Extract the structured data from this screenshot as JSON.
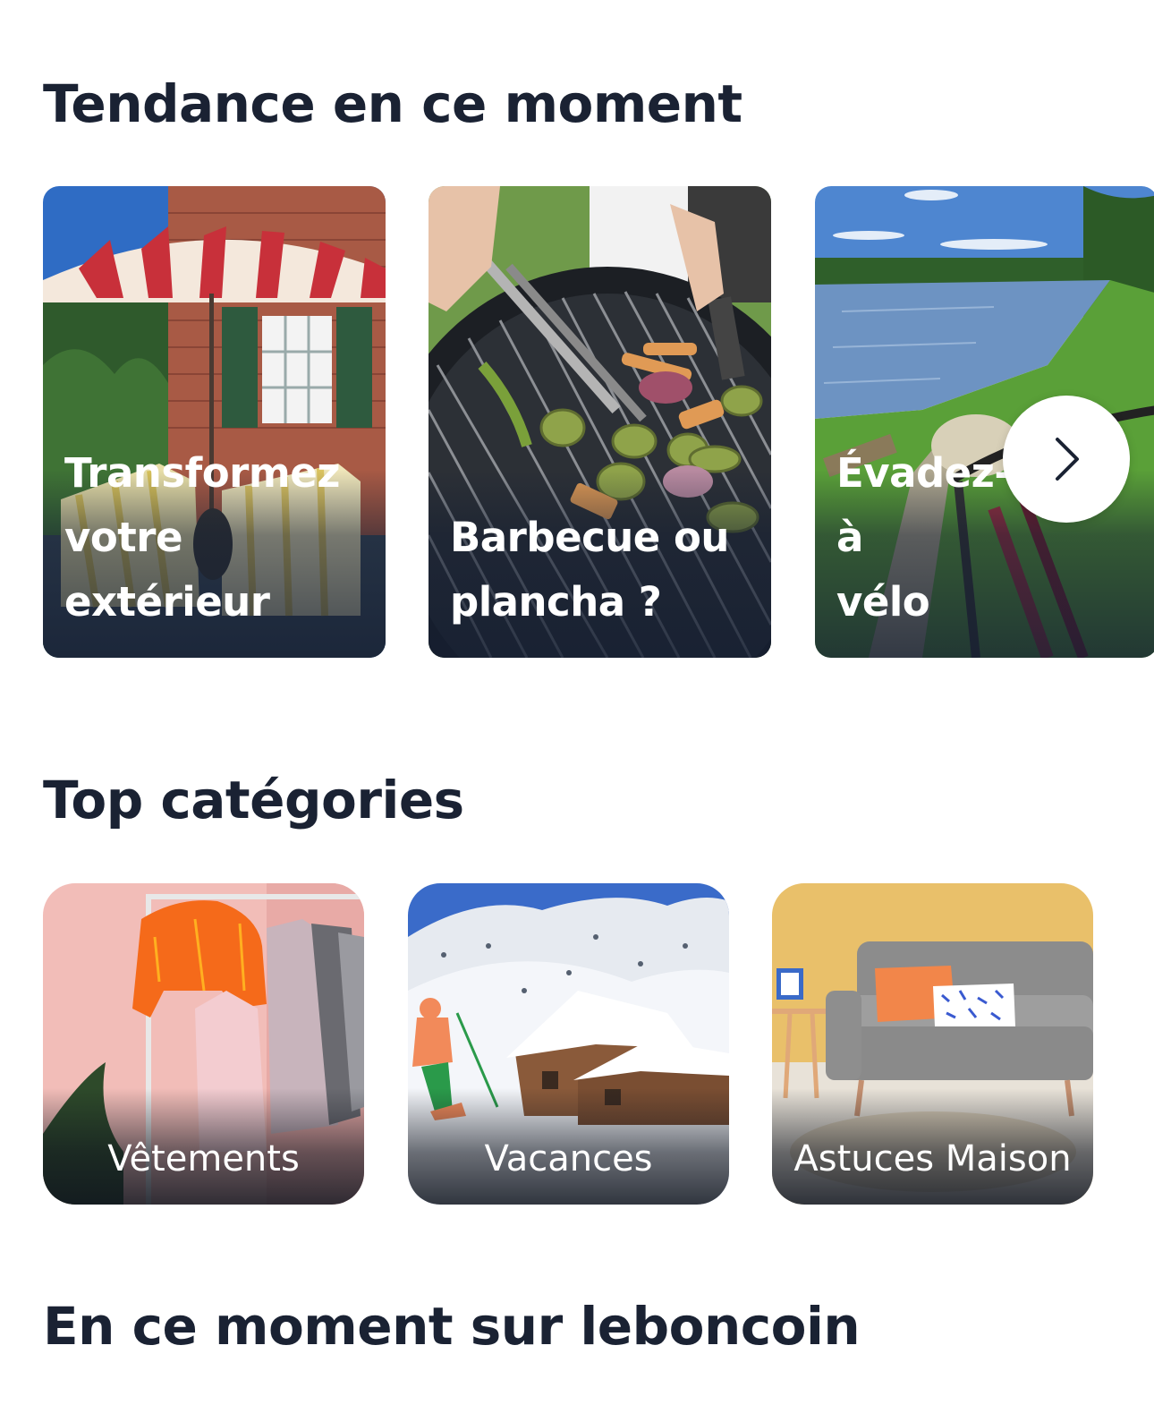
{
  "trending": {
    "title": "Tendance en ce moment",
    "cards": [
      {
        "line1": "Transformez",
        "line2": "votre extérieur"
      },
      {
        "line1": "Barbecue ou",
        "line2": "plancha ?"
      },
      {
        "line1": "Évadez-vous à",
        "line2": "vélo"
      }
    ],
    "next_icon": "chevron-right-icon"
  },
  "categories": {
    "title": "Top catégories",
    "items": [
      {
        "label": "Vêtements"
      },
      {
        "label": "Vacances"
      },
      {
        "label": "Astuces Maison"
      }
    ]
  },
  "now": {
    "title": "En ce moment sur leboncoin"
  }
}
